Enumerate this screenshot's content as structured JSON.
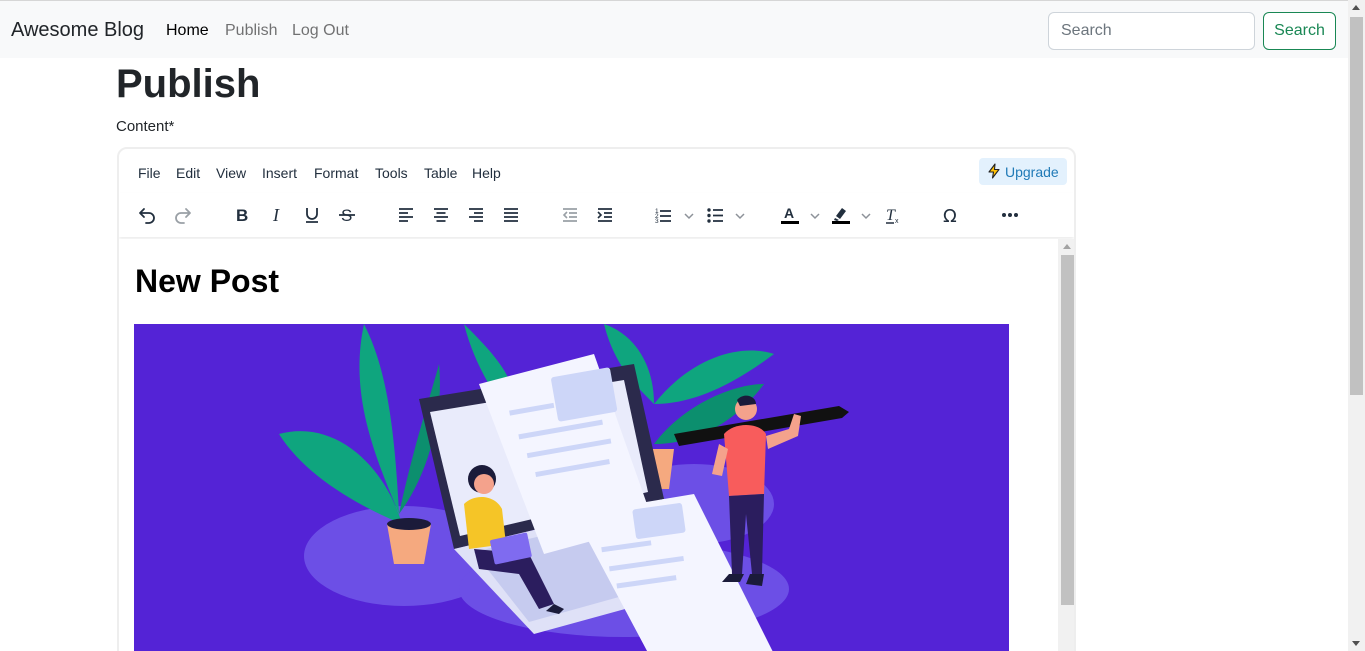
{
  "navbar": {
    "brand": "Awesome Blog",
    "links": [
      {
        "label": "Home",
        "active": true
      },
      {
        "label": "Publish",
        "active": false
      },
      {
        "label": "Log Out",
        "active": false
      }
    ],
    "search_placeholder": "Search",
    "search_value": "",
    "search_button": "Search"
  },
  "page": {
    "title": "Publish",
    "content_label": "Content*"
  },
  "editor": {
    "menus": [
      "File",
      "Edit",
      "View",
      "Insert",
      "Format",
      "Tools",
      "Table",
      "Help"
    ],
    "upgrade_label": "Upgrade",
    "toolbar_icons": [
      "undo-icon",
      "redo-icon",
      "bold-icon",
      "italic-icon",
      "underline-icon",
      "strikethrough-icon",
      "align-left-icon",
      "align-center-icon",
      "align-right-icon",
      "align-justify-icon",
      "outdent-icon",
      "indent-icon",
      "numbered-list-icon",
      "bullet-list-icon",
      "text-color-icon",
      "highlight-color-icon",
      "clear-formatting-icon",
      "special-character-icon",
      "more-icon"
    ],
    "content": {
      "heading": "New Post",
      "image": "blog-illustration"
    }
  },
  "colors": {
    "accent_green": "#198754",
    "hero_background": "#5423d6",
    "upgrade_bg": "#e3f1fd",
    "upgrade_text": "#207ab7"
  }
}
